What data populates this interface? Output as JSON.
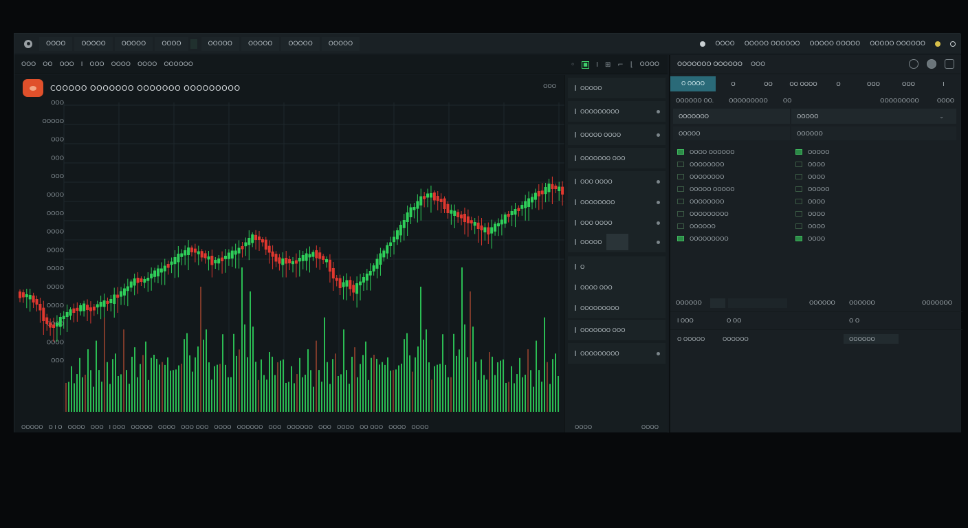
{
  "topbar": {
    "nav": [
      "OOOO",
      "OOOOO",
      "OOOOO",
      "OOOO",
      "OOOOO",
      "OOOOO",
      "OOOOO",
      "OOOOO"
    ],
    "right": [
      "OOOO",
      "OOOOO OOOOOO",
      "OOOOO OOOOO",
      "OOOOO OOOOOO"
    ]
  },
  "chart_toolbar": {
    "items": [
      "OOO",
      "OO",
      "OOO",
      "I",
      "OOO",
      "OOOO",
      "OOOO",
      "OOOOOO"
    ],
    "tools_label": "OOOO"
  },
  "chart": {
    "title": "COOOOO OOOOOOO OOOOOOO OOOOOOOOO",
    "corner": "OOO",
    "price_ticks": [
      "OOO",
      "OOOOO",
      "OOO",
      "OOO",
      "OOO",
      "OOOO",
      "OOOO",
      "OOOO",
      "OOOO",
      "OOOO",
      "OOOO",
      "OOOO",
      "OOOO",
      "OOOO",
      "OOO"
    ],
    "x_ticks": [
      "OOOOO",
      "O I O",
      "OOOO",
      "OOO",
      "I OOO",
      "OOOOO",
      "OOOO",
      "OOO OOO",
      "OOOO",
      "OOOOOO",
      "OOO",
      "OOOOOO",
      "OOO",
      "OOOO",
      "OO OOO",
      "OOOO",
      "OOOO"
    ]
  },
  "chart_data": {
    "type": "candlestick",
    "candles_summary": "price trends up from ~left low to right high with pullbacks",
    "close_path": [
      318,
      322,
      330,
      352,
      365,
      360,
      348,
      342,
      338,
      335,
      340,
      332,
      330,
      326,
      318,
      312,
      300,
      296,
      298,
      288,
      284,
      278,
      270,
      262,
      255,
      252,
      258,
      262,
      270,
      268,
      262,
      258,
      252,
      242,
      234,
      236,
      248,
      262,
      270,
      268,
      272,
      265,
      262,
      258,
      262,
      270,
      292,
      304,
      300,
      312,
      298,
      290,
      276,
      262,
      248,
      234,
      220,
      200,
      190,
      178,
      172,
      176,
      182,
      196,
      200,
      205,
      210,
      216,
      222,
      226,
      218,
      210,
      200,
      196,
      188,
      182,
      172,
      168,
      160,
      162,
      168
    ],
    "volume_heights": [
      60,
      40,
      72,
      55,
      48,
      80,
      62,
      45,
      88,
      70,
      52,
      95,
      66,
      58,
      120,
      74,
      50,
      64,
      82,
      60,
      78,
      110,
      66,
      54,
      70,
      96,
      62,
      58,
      80,
      118,
      66,
      72,
      90,
      102,
      60,
      74,
      84,
      66,
      58,
      70,
      88,
      62,
      76,
      140,
      100,
      84,
      72,
      66,
      92,
      210,
      150,
      110,
      78,
      62,
      58,
      70,
      86,
      94,
      66,
      58,
      72,
      104,
      88,
      120,
      190,
      130,
      98,
      146,
      120,
      84,
      66,
      70,
      58,
      62,
      76,
      82,
      66,
      60,
      72,
      88
    ]
  },
  "orderbook": {
    "rows": [
      "OOOOO",
      "OOOOOOOOO",
      "OOOOO OOOO",
      "OOOOOOO OOO",
      "OOO OOOO",
      "OOOOOOOO",
      "OOO OOOO",
      "OOOOO",
      "O",
      "OOOO OOO",
      "OOOOOOOOO",
      "OOOOOOO OOO",
      "OOOOOOOOO"
    ],
    "footer_left": "OOOO",
    "footer_right": "OOOO"
  },
  "right_panel": {
    "title": "OOOOOOO OOOOOO",
    "title_sub": "OOO",
    "tabs": [
      "O OOOO",
      "O",
      "OO",
      "OO OOOO",
      "O",
      "OOO",
      "OOO",
      "I"
    ],
    "sub_left": [
      "OOOOOO OO.",
      "OOOOOOOOO",
      "OO"
    ],
    "sub_right": [
      "OOOOOOOOO",
      "OOOO"
    ],
    "left_col": {
      "head": "OOOOOOO",
      "sub": "OOOOO",
      "rows": [
        "OOOO OOOOOO",
        "OOOOOOOO",
        "OOOOOOOO",
        "OOOOO OOOOO",
        "OOOOOOOO",
        "OOOOOOOOO",
        "OOOOOO",
        "OOOOOOOOO"
      ]
    },
    "right_col": {
      "head": "OOOOO",
      "sub": "OOOOOO",
      "rows": [
        "OOOOO",
        "OOOO",
        "OOOO",
        "OOOOO",
        "OOOO",
        "OOOO",
        "OOOO",
        "OOOO"
      ]
    },
    "bottom": {
      "row1": [
        "OOOOOO",
        "OOOOOO",
        "OOOOOO",
        "OOOOOOO"
      ],
      "row2": [
        "I OOO",
        "O OO",
        "O O"
      ],
      "row3": [
        "O OOOOO",
        "OOOOOO",
        "OOOOOO"
      ]
    }
  },
  "colors": {
    "up": "#2fd05a",
    "down": "#e0382f",
    "accent": "#2a6a78",
    "brand": "#e0502b"
  }
}
